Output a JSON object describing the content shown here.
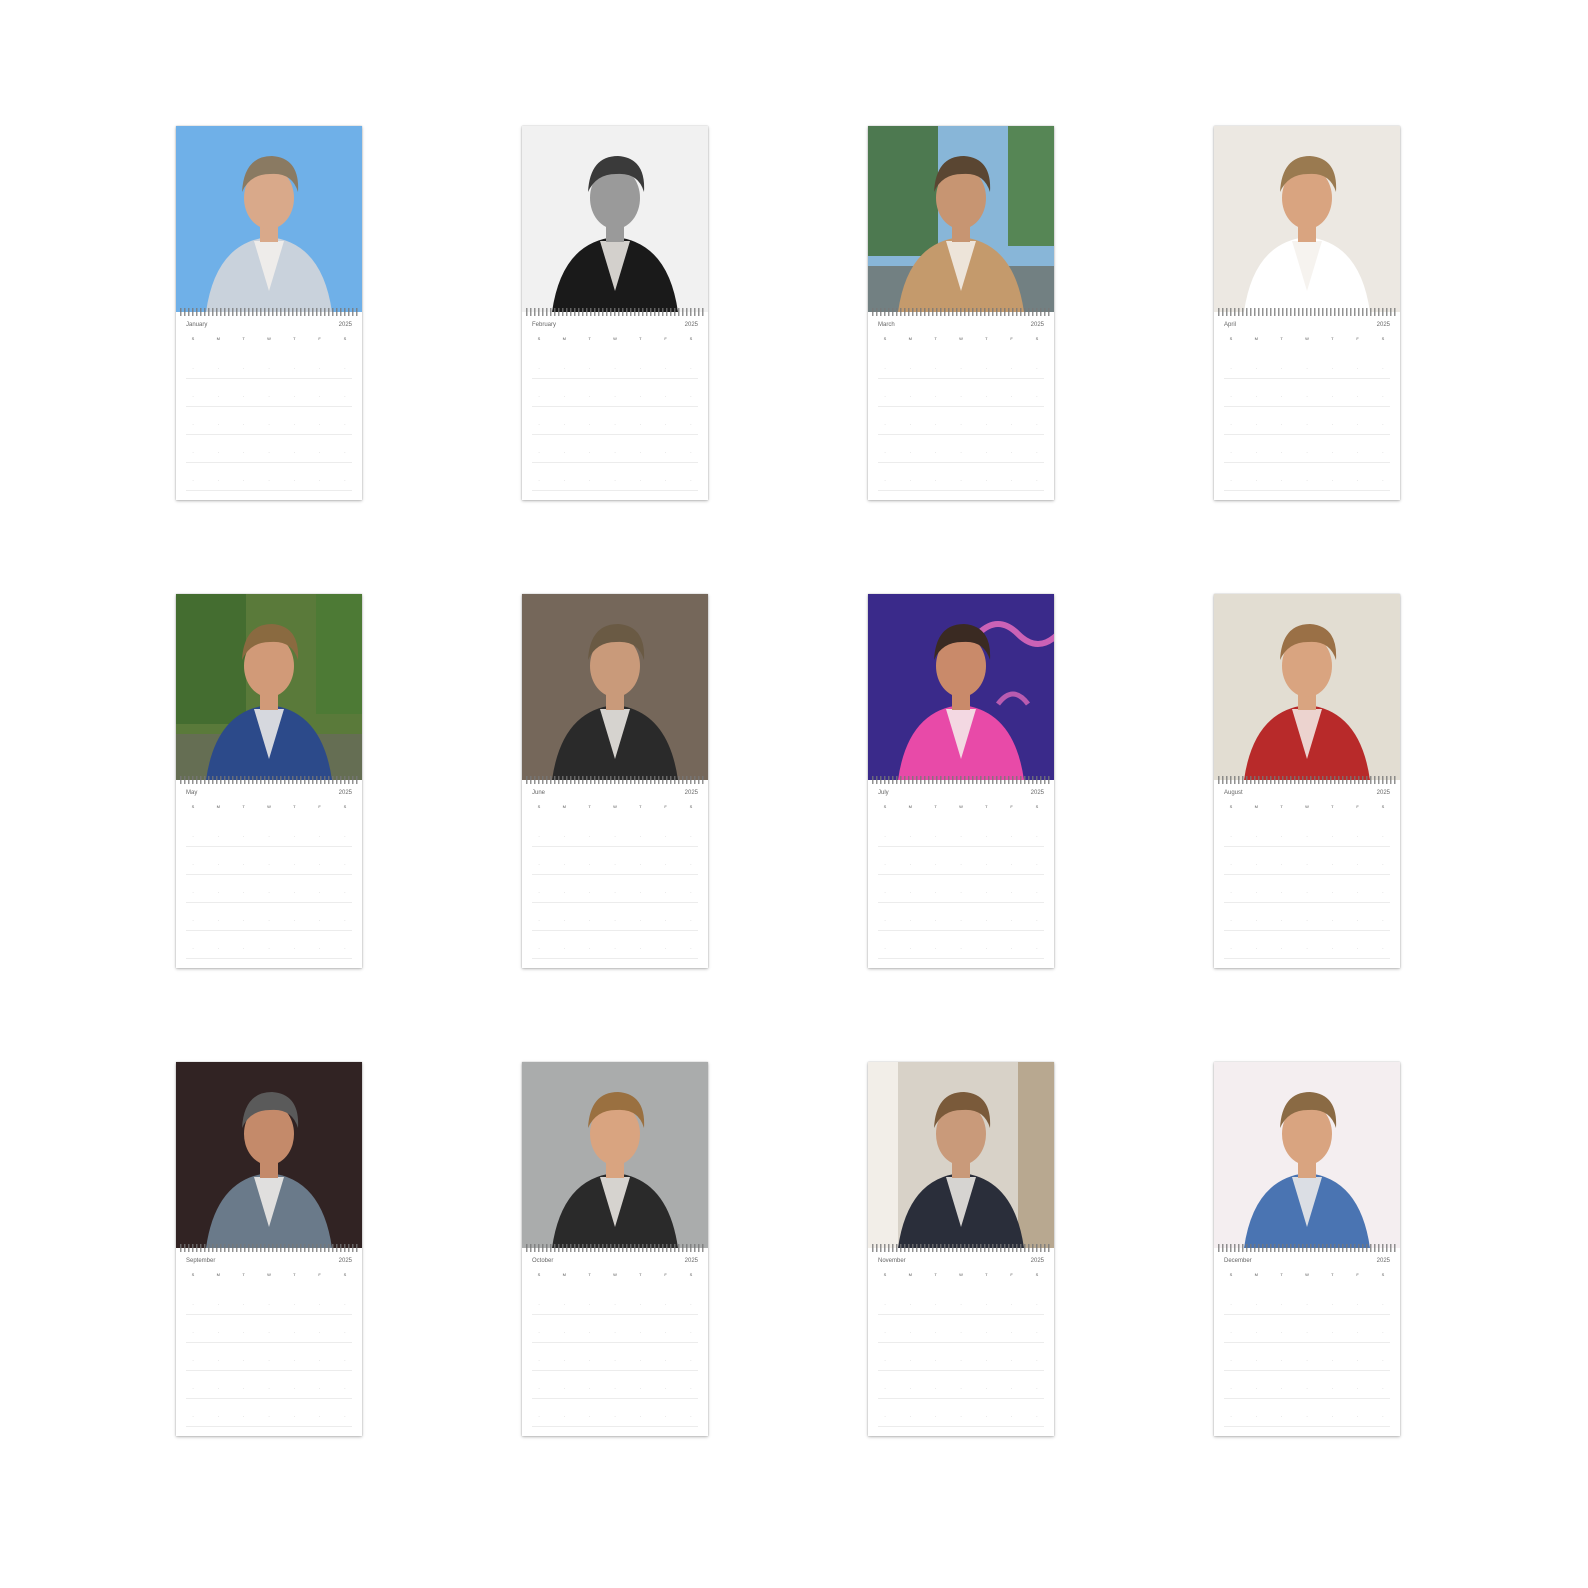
{
  "calendar": {
    "year": "2025",
    "weekdays": [
      "S",
      "M",
      "T",
      "W",
      "T",
      "F",
      "S"
    ],
    "months": [
      {
        "name": "January",
        "photo": {
          "bg": "#6fb0e8",
          "accent": "#c9d2dc",
          "hair": "#8a7a62",
          "skin": "#d9a98a",
          "style": "light"
        }
      },
      {
        "name": "February",
        "photo": {
          "bg": "#f1f1f1",
          "accent": "#1a1a1a",
          "hair": "#3a3a3a",
          "skin": "#9a9a9a",
          "style": "mono"
        }
      },
      {
        "name": "March",
        "photo": {
          "bg": "#88b6d8",
          "accent": "#c49a6c",
          "hair": "#5a4632",
          "skin": "#c79572",
          "style": "outdoor"
        }
      },
      {
        "name": "April",
        "photo": {
          "bg": "#ece8e2",
          "accent": "#ffffff",
          "hair": "#9a7a50",
          "skin": "#d9a480",
          "style": "light"
        }
      },
      {
        "name": "May",
        "photo": {
          "bg": "#5a7a3a",
          "accent": "#2c4a8a",
          "hair": "#8a6a40",
          "skin": "#d19a78",
          "style": "outdoor"
        }
      },
      {
        "name": "June",
        "photo": {
          "bg": "#8a7a6a",
          "accent": "#2a2a2a",
          "hair": "#6a5a44",
          "skin": "#c99a7a",
          "style": "dark"
        }
      },
      {
        "name": "July",
        "photo": {
          "bg": "#3a2a8a",
          "accent": "#e84aa8",
          "hair": "#3a2a22",
          "skin": "#c98a6a",
          "style": "neon"
        }
      },
      {
        "name": "August",
        "photo": {
          "bg": "#e2ddd2",
          "accent": "#b82a2a",
          "hair": "#9a7046",
          "skin": "#d9a480",
          "style": "light"
        }
      },
      {
        "name": "September",
        "photo": {
          "bg": "#3a2a2a",
          "accent": "#6a7a8a",
          "hair": "#5a5a5a",
          "skin": "#c48a6a",
          "style": "dark"
        }
      },
      {
        "name": "October",
        "photo": {
          "bg": "#c8cacb",
          "accent": "#2a2a2a",
          "hair": "#9a7040",
          "skin": "#d9a480",
          "style": "dark"
        }
      },
      {
        "name": "November",
        "photo": {
          "bg": "#d8d2c8",
          "accent": "#2a2e3a",
          "hair": "#7a5a3a",
          "skin": "#c99a7a",
          "style": "indoor"
        }
      },
      {
        "name": "December",
        "photo": {
          "bg": "#f4eef0",
          "accent": "#4a74b2",
          "hair": "#8a6a44",
          "skin": "#d9a480",
          "style": "light"
        }
      }
    ]
  }
}
